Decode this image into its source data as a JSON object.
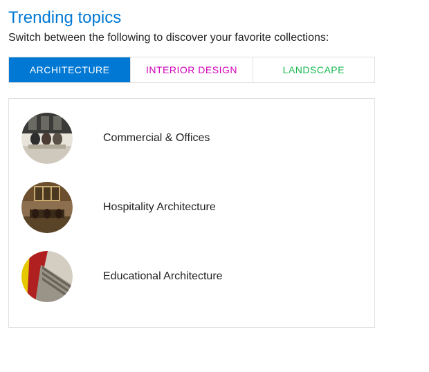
{
  "heading": "Trending topics",
  "subtitle": "Switch between the following to discover your favorite collections:",
  "tabs": [
    {
      "label": "ARCHITECTURE",
      "active": true
    },
    {
      "label": "INTERIOR DESIGN",
      "active": false
    },
    {
      "label": "LANDSCAPE",
      "active": false
    }
  ],
  "items": [
    {
      "label": "Commercial & Offices",
      "thumb": "office"
    },
    {
      "label": "Hospitality Architecture",
      "thumb": "hospitality"
    },
    {
      "label": "Educational Architecture",
      "thumb": "educational"
    }
  ]
}
